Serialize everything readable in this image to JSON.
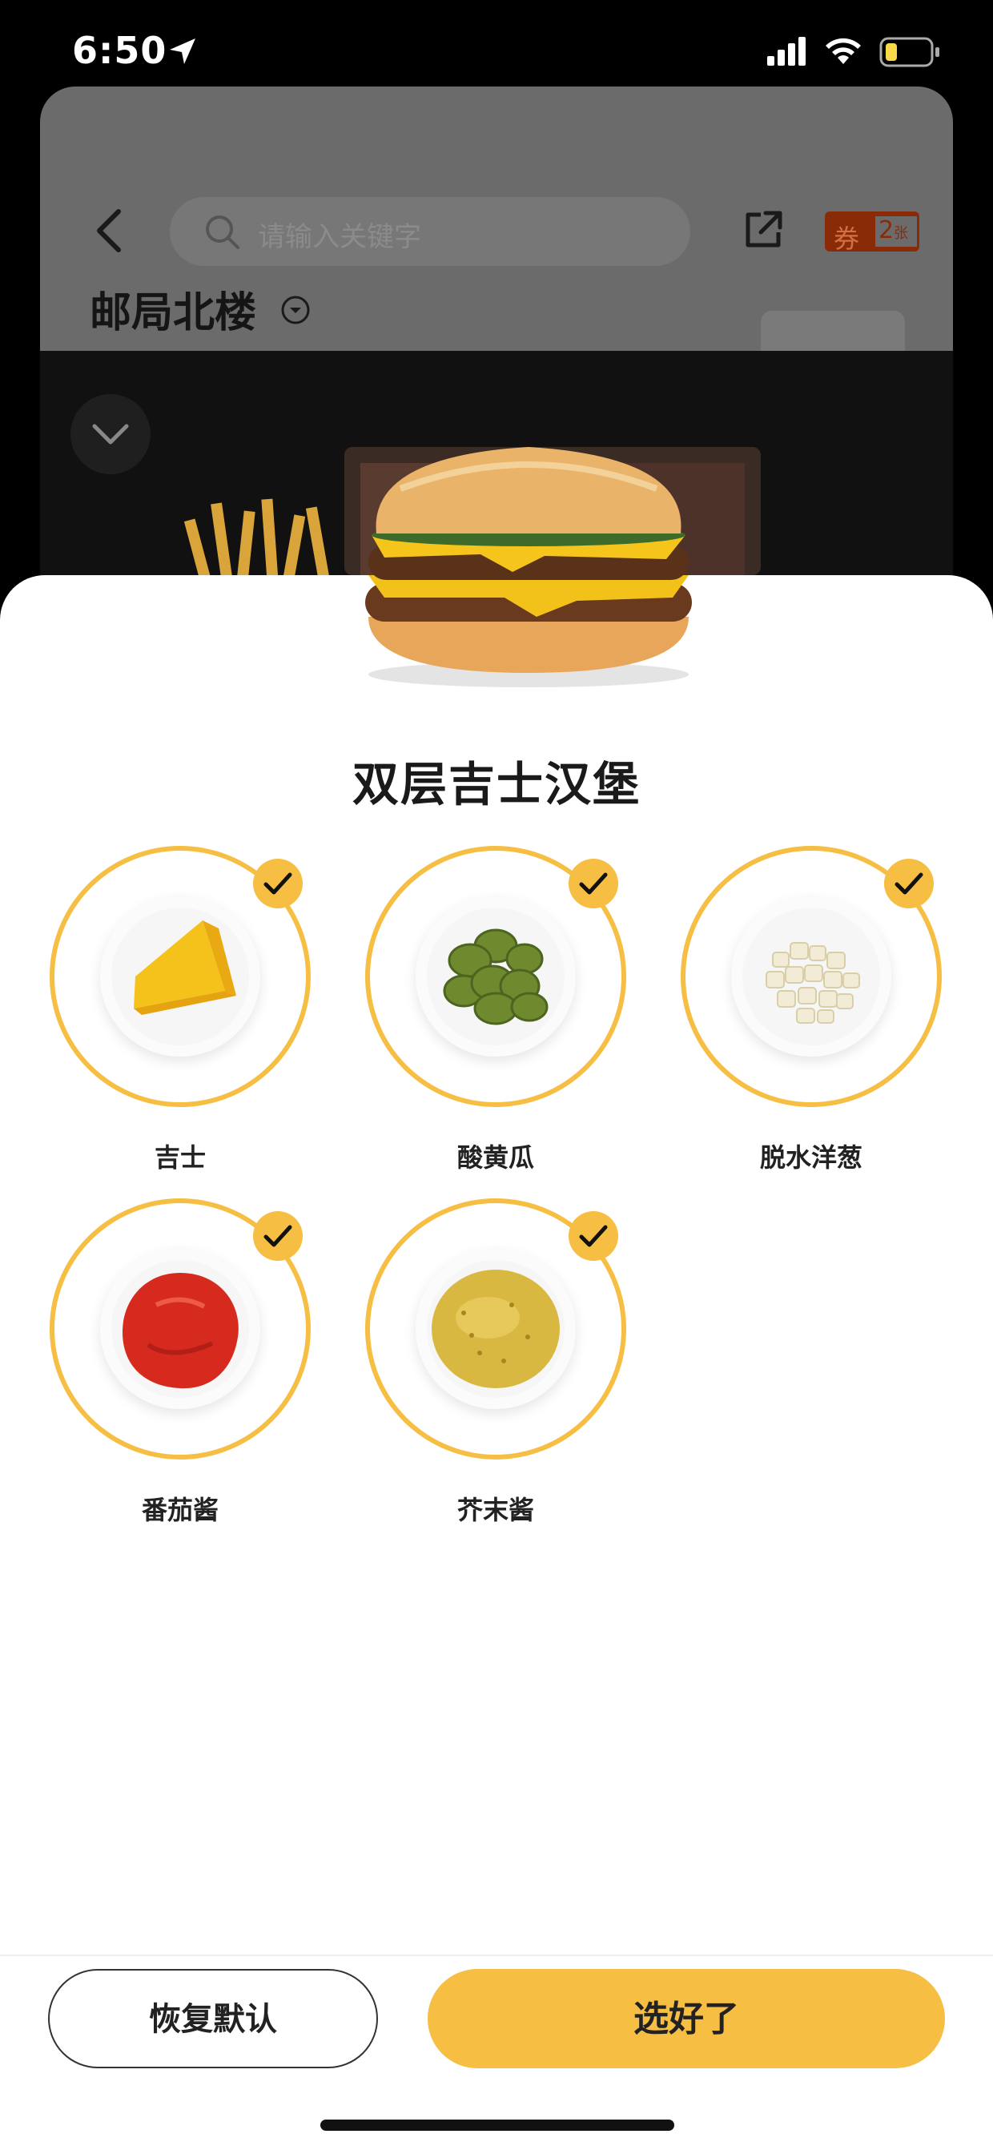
{
  "status_bar": {
    "time": "6:50",
    "battery_level": 0.2
  },
  "background_page": {
    "search_placeholder": "请输入关键字",
    "store_name": "邮局北楼",
    "coupon": {
      "label": "券",
      "count": "2",
      "unit": "张"
    }
  },
  "sheet": {
    "product_name": "双层吉士汉堡",
    "ingredients": [
      {
        "label": "吉士",
        "selected": true,
        "icon": "cheese-slice-icon"
      },
      {
        "label": "酸黄瓜",
        "selected": true,
        "icon": "pickles-icon"
      },
      {
        "label": "脱水洋葱",
        "selected": true,
        "icon": "onion-icon"
      },
      {
        "label": "番茄酱",
        "selected": true,
        "icon": "ketchup-icon"
      },
      {
        "label": "芥末酱",
        "selected": true,
        "icon": "mustard-icon"
      }
    ]
  },
  "footer": {
    "reset_label": "恢复默认",
    "confirm_label": "选好了"
  },
  "colors": {
    "accent": "#f6be43",
    "text": "#222222"
  }
}
